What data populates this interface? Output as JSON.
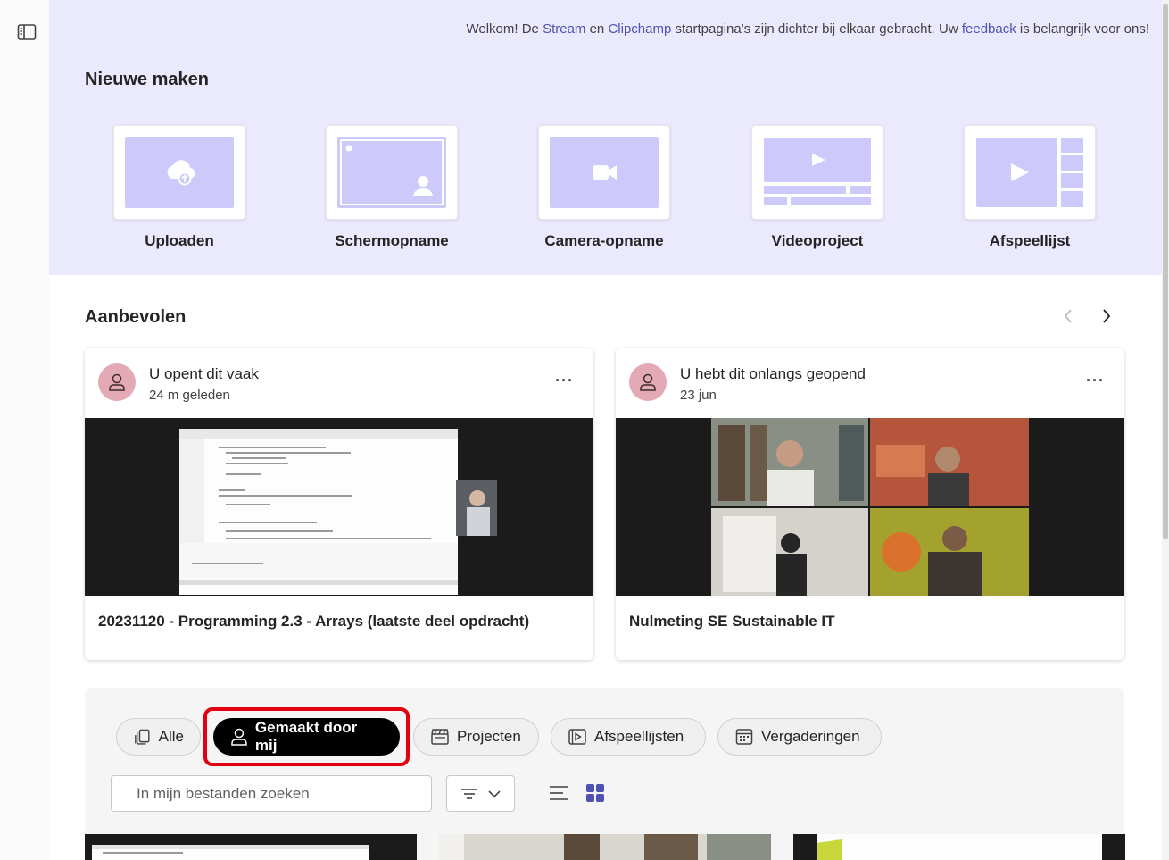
{
  "rail": {
    "toggle_icon": "sidebar-toggle-icon"
  },
  "welcome": {
    "part1": "Welkom! De ",
    "stream_link": "Stream",
    "part2": " en ",
    "clipchamp_link": "Clipchamp",
    "part3": " startpagina's zijn dichter bij elkaar gebracht. Uw ",
    "feedback_link": "feedback",
    "part4": " is belangrijk voor ons!"
  },
  "create": {
    "title": "Nieuwe maken",
    "tiles": [
      {
        "label": "Uploaden",
        "icon": "upload-cloud-icon"
      },
      {
        "label": "Schermopname",
        "icon": "screen-recording-icon"
      },
      {
        "label": "Camera-opname",
        "icon": "camera-icon"
      },
      {
        "label": "Videoproject",
        "icon": "video-project-icon"
      },
      {
        "label": "Afspeellijst",
        "icon": "playlist-icon"
      }
    ]
  },
  "recommended": {
    "title": "Aanbevolen",
    "cards": [
      {
        "reason": "U opent dit vaak",
        "time": "24 m geleden",
        "title": "20231120 - Programming 2.3 - Arrays (laatste deel opdracht)"
      },
      {
        "reason": "U hebt dit onlangs geopend",
        "time": "23 jun",
        "title": "Nulmeting SE Sustainable IT"
      }
    ]
  },
  "filters": {
    "pills": [
      {
        "label": "Alle",
        "icon": "all-files-icon"
      },
      {
        "label": "Gemaakt door mij",
        "icon": "person-icon",
        "active": true
      },
      {
        "label": "Projecten",
        "icon": "clapperboard-icon"
      },
      {
        "label": "Afspeellijsten",
        "icon": "playlist-play-icon"
      },
      {
        "label": "Vergaderingen",
        "icon": "calendar-icon"
      }
    ],
    "search_placeholder": "In mijn bestanden zoeken"
  },
  "colors": {
    "hero_bg": "#ebe9fd",
    "accent": "#4f52b2",
    "tile_fill": "#cdc9fb",
    "highlight": "#e3000f"
  }
}
